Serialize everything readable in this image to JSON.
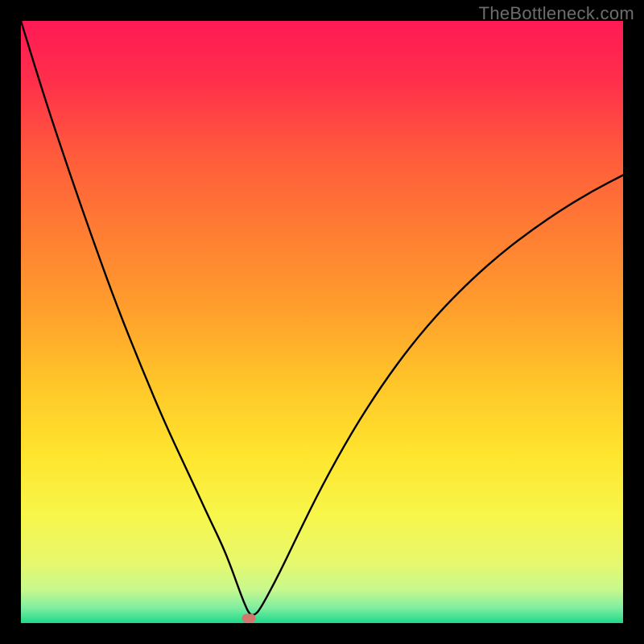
{
  "watermark": "TheBottleneck.com",
  "colors": {
    "frame": "#000000",
    "curve": "#000000",
    "marker": "#d1776c",
    "gradient_stops": [
      {
        "offset": 0.0,
        "color": "#ff1a55"
      },
      {
        "offset": 0.1,
        "color": "#ff2f4b"
      },
      {
        "offset": 0.22,
        "color": "#ff5a3c"
      },
      {
        "offset": 0.35,
        "color": "#ff7d33"
      },
      {
        "offset": 0.48,
        "color": "#ff9f2c"
      },
      {
        "offset": 0.6,
        "color": "#ffc529"
      },
      {
        "offset": 0.72,
        "color": "#ffe52e"
      },
      {
        "offset": 0.82,
        "color": "#f7f64a"
      },
      {
        "offset": 0.9,
        "color": "#e7f86d"
      },
      {
        "offset": 0.945,
        "color": "#c7f88e"
      },
      {
        "offset": 0.975,
        "color": "#7eeea0"
      },
      {
        "offset": 1.0,
        "color": "#1fd88a"
      }
    ]
  },
  "chart_data": {
    "type": "line",
    "title": "",
    "xlabel": "",
    "ylabel": "",
    "xlim": [
      0,
      100
    ],
    "ylim": [
      0,
      100
    ],
    "grid": false,
    "legend": false,
    "marker": {
      "x": 37.8,
      "y": 0.8
    },
    "series": [
      {
        "name": "curve",
        "x": [
          0,
          4,
          8,
          12,
          16,
          20,
          24,
          28,
          31,
          33.5,
          35,
          36,
          37,
          38,
          39,
          40,
          42,
          44,
          46,
          50,
          55,
          60,
          65,
          70,
          75,
          80,
          85,
          90,
          95,
          100
        ],
        "y": [
          100,
          87,
          75,
          63.5,
          52.5,
          42.5,
          33,
          24.5,
          18,
          12.8,
          9,
          6.2,
          3.5,
          1.3,
          1.4,
          2.8,
          6.5,
          10.5,
          14.7,
          22.8,
          31.8,
          39.6,
          46.4,
          52.2,
          57.2,
          61.6,
          65.4,
          68.8,
          71.8,
          74.4
        ]
      }
    ]
  }
}
